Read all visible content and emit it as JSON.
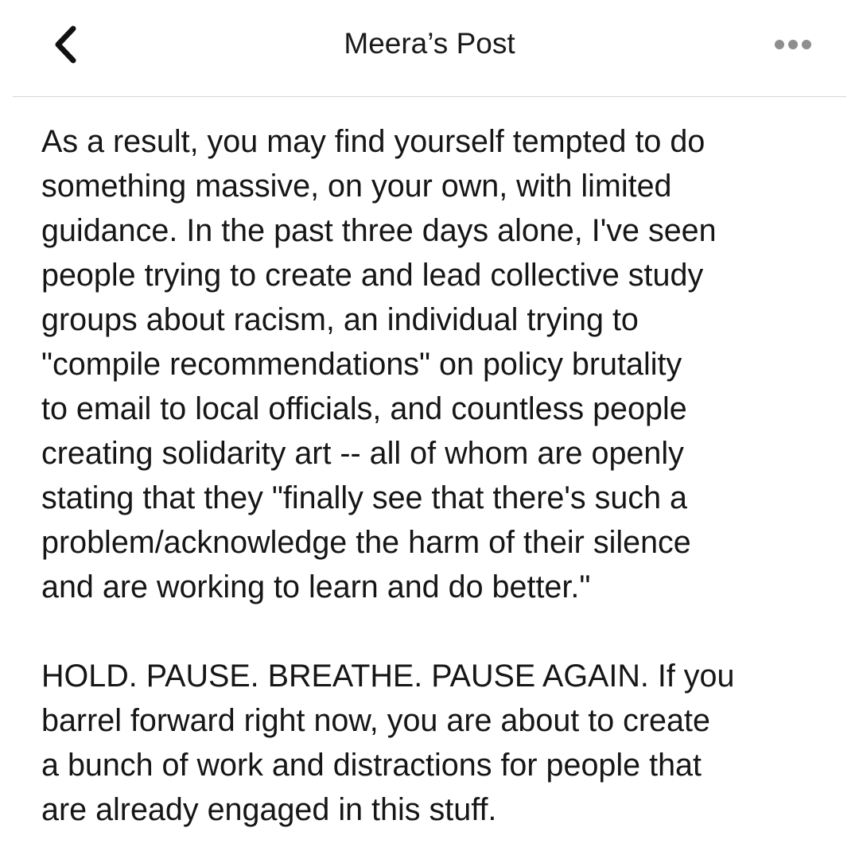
{
  "header": {
    "title": "Meera’s Post",
    "back_icon": "chevron-left-icon",
    "more_icon": "ellipsis-horizontal-icon"
  },
  "post": {
    "paragraphs": [
      "As a result, you may find yourself tempted to do\nsomething massive, on your own, with limited\nguidance. In the past three days alone, I've seen\npeople trying to create and lead collective study\ngroups about racism, an individual trying to\n\"compile recommendations\" on policy brutality\nto email to local officials, and countless people\ncreating solidarity art -- all of whom are openly\nstating that they \"finally see that there's such a\nproblem/acknowledge the harm of their silence\nand are working to learn and do better.\"",
      "HOLD. PAUSE. BREATHE. PAUSE AGAIN. If you\nbarrel forward right now, you are about to create\na bunch of work and distractions for people that\nare already engaged in this stuff."
    ]
  },
  "colors": {
    "text": "#161616",
    "divider": "#d6d6d6",
    "background": "#ffffff",
    "icon_dots": "#8e8e8e"
  }
}
